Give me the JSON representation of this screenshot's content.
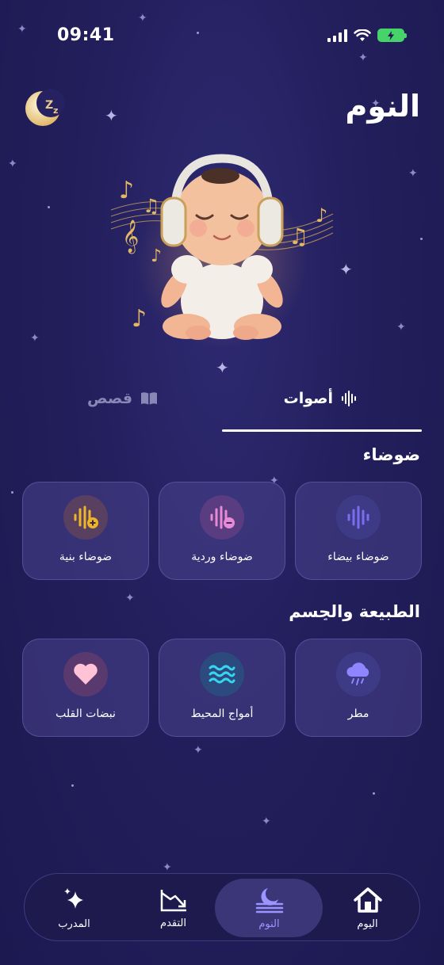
{
  "status_bar": {
    "time": "09:41"
  },
  "header": {
    "title": "النوم"
  },
  "tabs": [
    {
      "label": "أصوات",
      "icon": "waveform-icon",
      "active": true
    },
    {
      "label": "قصص",
      "icon": "book-icon",
      "active": false
    }
  ],
  "sections": [
    {
      "title": "ضوضاء",
      "items": [
        {
          "label": "ضوضاء بيضاء",
          "icon": "white-noise-waveform-icon",
          "color": "#7c6cf0"
        },
        {
          "label": "ضوضاء وردية",
          "icon": "pink-noise-waveform-icon",
          "color": "#e88bd6"
        },
        {
          "label": "ضوضاء بنية",
          "icon": "brown-noise-waveform-icon",
          "color": "#f0b429"
        }
      ]
    },
    {
      "title": "الطبيعة والجسم",
      "items": [
        {
          "label": "مطر",
          "icon": "rain-cloud-icon",
          "color": "#8f86ff"
        },
        {
          "label": "أمواج المحيط",
          "icon": "ocean-waves-icon",
          "color": "#35d6f0"
        },
        {
          "label": "نبضات القلب",
          "icon": "heart-icon",
          "color": "#ffc2d6"
        }
      ]
    }
  ],
  "bottom_nav": [
    {
      "label": "اليوم",
      "icon": "home-icon",
      "active": false
    },
    {
      "label": "النوم",
      "icon": "moon-icon",
      "active": true
    },
    {
      "label": "التقدم",
      "icon": "trend-chart-icon",
      "active": false
    },
    {
      "label": "المدرب",
      "icon": "sparkle-icon",
      "active": false
    }
  ],
  "colors": {
    "background": "#231f5c",
    "accent": "#8f86ff",
    "active_nav_text": "#9c94ff"
  }
}
